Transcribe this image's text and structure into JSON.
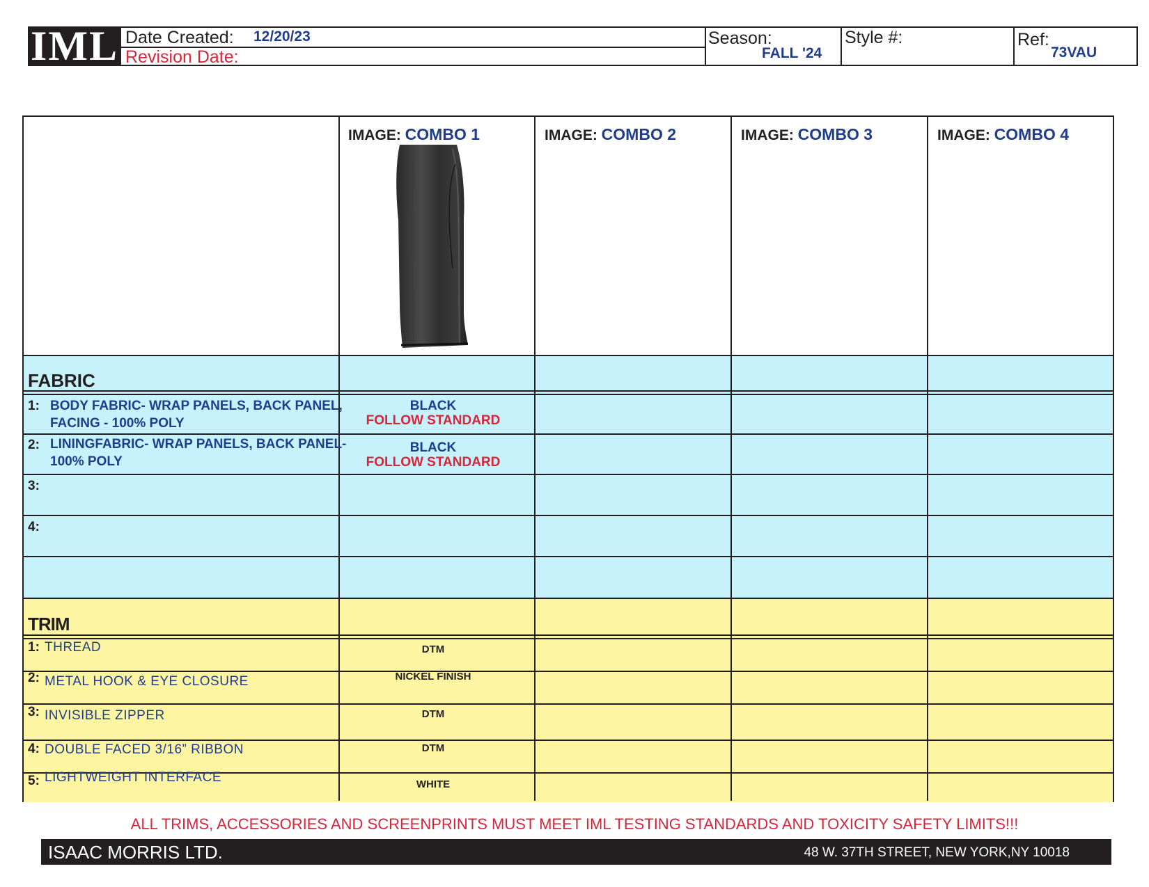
{
  "header": {
    "logo": "IML",
    "date_created_label": "Date Created:",
    "date_created": "12/20/23",
    "revision_label": "Revision Date:",
    "revision_date": "",
    "season_label": "Season:",
    "season": "FALL '24",
    "style_label": "Style #:",
    "style": "",
    "ref_label": "Ref:",
    "ref": "73VAU"
  },
  "combos": [
    {
      "prefix": "IMAGE:",
      "name": "COMBO 1"
    },
    {
      "prefix": "IMAGE:",
      "name": "COMBO 2"
    },
    {
      "prefix": "IMAGE:",
      "name": "COMBO 3"
    },
    {
      "prefix": "IMAGE:",
      "name": "COMBO 4"
    }
  ],
  "fabric": {
    "title": "FABRIC",
    "rows": [
      {
        "num": "1:",
        "desc_line1": "BODY FABRIC- WRAP PANELS, BACK PANEL,",
        "desc_line2": "FACING - 100% POLY",
        "color": "BLACK",
        "note": "FOLLOW STANDARD"
      },
      {
        "num": "2:",
        "desc_line1": "LININGFABRIC- WRAP PANELS, BACK PANEL-",
        "desc_line2": "100% POLY",
        "color": "BLACK",
        "note": "FOLLOW STANDARD"
      },
      {
        "num": "3:",
        "desc_line1": "",
        "desc_line2": "",
        "color": "",
        "note": ""
      },
      {
        "num": "4:",
        "desc_line1": "",
        "desc_line2": "",
        "color": "",
        "note": ""
      }
    ]
  },
  "trim": {
    "title": "TRIM",
    "rows": [
      {
        "num": "1:",
        "desc": "THREAD",
        "value": "DTM"
      },
      {
        "num": "2:",
        "desc": "METAL HOOK & EYE CLOSURE",
        "value": "NICKEL FINISH"
      },
      {
        "num": "3:",
        "desc": "INVISIBLE ZIPPER",
        "value": "DTM"
      },
      {
        "num": "4:",
        "desc": "DOUBLE FACED 3/16” RIBBON",
        "value": "DTM"
      },
      {
        "num": "5:",
        "desc": "LIGHTWEIGHT INTERFACE",
        "value": "WHITE"
      }
    ]
  },
  "footer": {
    "warning": "ALL TRIMS, ACCESSORIES AND SCREENPRINTS MUST MEET IML TESTING STANDARDS AND TOXICITY SAFETY LIMITS!!!",
    "company": "ISAAC MORRIS LTD.",
    "address": "48 W. 37TH STREET, NEW YORK,NY 10018"
  },
  "colors": {
    "fabric_bg": "#c7f1fb",
    "trim_bg": "#fdf5a2",
    "accent_blue": "#1f3d8c",
    "accent_red": "#d6263a"
  },
  "illustration": "black-midi-skirt"
}
